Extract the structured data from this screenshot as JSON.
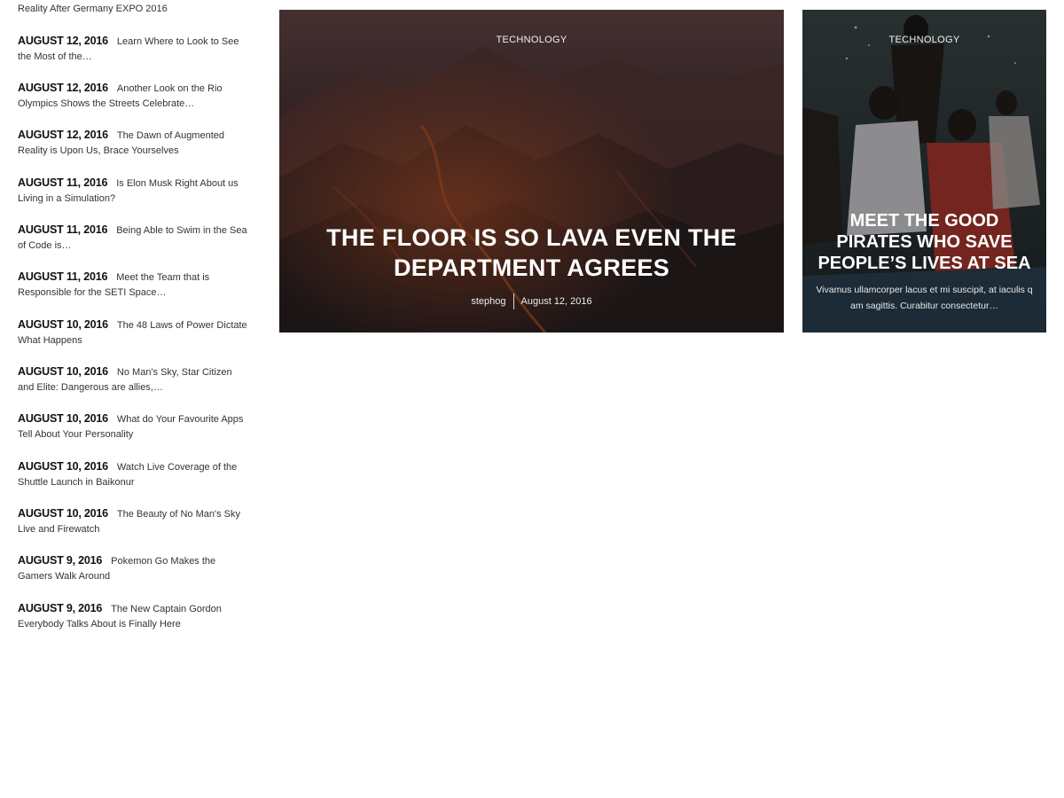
{
  "sidebar": {
    "partial_title": "Reality After Germany EXPO 2016",
    "items": [
      {
        "date": "AUGUST 12, 2016",
        "title": "Learn Where to Look to See the Most of the…"
      },
      {
        "date": "AUGUST 12, 2016",
        "title": "Another Look on the Rio Olympics Shows the Streets Celebrate…"
      },
      {
        "date": "AUGUST 12, 2016",
        "title": "The Dawn of Augmented Reality is Upon Us, Brace Yourselves"
      },
      {
        "date": "AUGUST 11, 2016",
        "title": "Is Elon Musk Right About us Living in a Simulation?"
      },
      {
        "date": "AUGUST 11, 2016",
        "title": "Being Able to Swim in the Sea of Code is…"
      },
      {
        "date": "AUGUST 11, 2016",
        "title": "Meet the Team that is Responsible for the SETI Space…"
      },
      {
        "date": "AUGUST 10, 2016",
        "title": "The 48 Laws of Power Dictate What Happens"
      },
      {
        "date": "AUGUST 10, 2016",
        "title": "No Man's Sky, Star Citizen and Elite: Dangerous are allies,…"
      },
      {
        "date": "AUGUST 10, 2016",
        "title": "What do Your Favourite Apps Tell About Your Personality"
      },
      {
        "date": "AUGUST 10, 2016",
        "title": "Watch Live Coverage of the Shuttle Launch in Baikonur"
      },
      {
        "date": "AUGUST 10, 2016",
        "title": "The Beauty of No Man's Sky Live and Firewatch"
      },
      {
        "date": "AUGUST 9, 2016",
        "title": "Pokemon Go Makes the Gamers Walk Around"
      },
      {
        "date": "AUGUST 9, 2016",
        "title": "The New Captain Gordon Everybody Talks About is Finally Here"
      }
    ]
  },
  "featured_main": {
    "category": "TECHNOLOGY",
    "title": "THE FLOOR IS SO LAVA EVEN THE DEPARTMENT AGREES",
    "author": "stephog",
    "date": "August 12, 2016"
  },
  "featured_side": {
    "category": "TECHNOLOGY",
    "title": "MEET THE GOOD PIRATES WHO SAVE PEOPLE’S LIVES AT SEA",
    "excerpt": "Vivamus ullamcorper lacus et mi suscipit, at iaculis q am sagittis. Curabitur consectetur…"
  }
}
